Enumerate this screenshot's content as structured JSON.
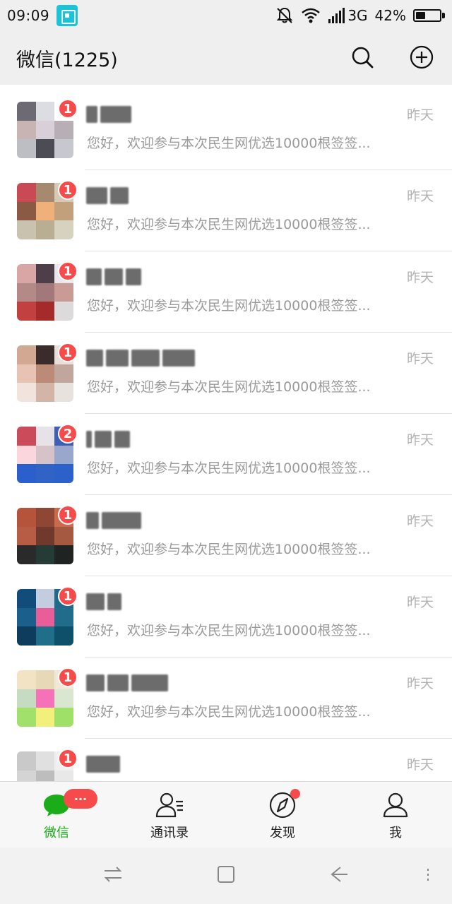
{
  "status_bar": {
    "time": "09:09",
    "network": "3G",
    "battery_percent": "42%",
    "battery_level": 0.42
  },
  "header": {
    "title": "微信(1225)",
    "icons": [
      "search-icon",
      "add-circle-icon"
    ]
  },
  "chats": [
    {
      "unread": "1",
      "time": "昨天",
      "preview": "您好，欢迎参与本次民生网优选10000根签签...",
      "avatar_colors": [
        "#6e6a73",
        "#dcdde2",
        "#ffffff",
        "#c9b4b4",
        "#d9cfd9",
        "#b8aeb5",
        "#bdbdc4",
        "#4c4c55",
        "#c7c7cf"
      ],
      "name_blocks": [
        16,
        44
      ]
    },
    {
      "unread": "1",
      "time": "昨天",
      "preview": "您好，欢迎参与本次民生网优选10000根签签...",
      "avatar_colors": [
        "#c94a55",
        "#a58a6f",
        "#d6c9b6",
        "#8a5a45",
        "#f0b07a",
        "#c2a07c",
        "#c9c2ae",
        "#b9ae92",
        "#d7d1c0"
      ],
      "name_blocks": [
        30,
        26
      ]
    },
    {
      "unread": "1",
      "time": "昨天",
      "preview": "您好，欢迎参与本次民生网优选10000根签签...",
      "avatar_colors": [
        "#d8a7a5",
        "#4e3e4a",
        "#e9e7ea",
        "#b48a86",
        "#a2787a",
        "#c89c94",
        "#c24040",
        "#a52a2a",
        "#dcdada"
      ],
      "name_blocks": [
        22,
        26,
        22
      ]
    },
    {
      "unread": "1",
      "time": "昨天",
      "preview": "您好，欢迎参与本次民生网优选10000根签签...",
      "avatar_colors": [
        "#d1a891",
        "#3a2c2a",
        "#e9dfd9",
        "#e7c3b3",
        "#bc8b77",
        "#c0a69c",
        "#f1e4dc",
        "#d2b5a7",
        "#e8e2de"
      ],
      "name_blocks": [
        24,
        32,
        40,
        46
      ]
    },
    {
      "unread": "2",
      "time": "昨天",
      "preview": "您好，欢迎参与本次民生网优选10000根签签...",
      "avatar_colors": [
        "#cc4b5a",
        "#e7e2e8",
        "#3d5fb4",
        "#fbd6dc",
        "#d6c3c7",
        "#9aa7cc",
        "#2a5fcc",
        "#3163c6",
        "#2b61c9"
      ],
      "name_blocks": [
        8,
        24,
        22
      ]
    },
    {
      "unread": "1",
      "time": "昨天",
      "preview": "您好，欢迎参与本次民生网优选10000根签签...",
      "avatar_colors": [
        "#b5533b",
        "#8d4733",
        "#c96a4e",
        "#b75c45",
        "#6f3a2b",
        "#a65941",
        "#2a2a2a",
        "#253b35",
        "#1f2422"
      ],
      "name_blocks": [
        18,
        56
      ]
    },
    {
      "unread": "1",
      "time": "昨天",
      "preview": "您好，欢迎参与本次民生网优选10000根签签...",
      "avatar_colors": [
        "#124c7a",
        "#c4cde0",
        "#1f6a8a",
        "#1b5f8c",
        "#e95e99",
        "#216c8a",
        "#0d3c5c",
        "#1f6e8a",
        "#0e4f6a"
      ],
      "name_blocks": [
        26,
        20
      ]
    },
    {
      "unread": "1",
      "time": "昨天",
      "preview": "您好，欢迎参与本次民生网优选10000根签签...",
      "avatar_colors": [
        "#f2e3c4",
        "#e7d8b8",
        "#efe8d6",
        "#c6dcc2",
        "#f572b9",
        "#d9e7d0",
        "#a1e06a",
        "#f2ef7a",
        "#9ee068"
      ],
      "name_blocks": [
        26,
        30,
        52
      ]
    },
    {
      "unread": "1",
      "time": "昨天",
      "preview": "",
      "avatar_colors": [
        "#c9c9c9",
        "#e0e0e0",
        "#efefef",
        "#d4d4d4",
        "#bdbdbd",
        "#e8e8e8",
        "#ccc",
        "#ddd",
        "#eee"
      ],
      "name_blocks": [
        48
      ]
    }
  ],
  "bottom_nav": {
    "items": [
      {
        "label": "微信",
        "icon": "chat-bubble-icon",
        "active": true
      },
      {
        "label": "通讯录",
        "icon": "contacts-icon",
        "active": false
      },
      {
        "label": "发现",
        "icon": "compass-icon",
        "active": false
      },
      {
        "label": "我",
        "icon": "person-icon",
        "active": false
      }
    ],
    "message_badge": "···"
  },
  "colors": {
    "accent_green": "#1aad19",
    "badge_red": "#f74b4b",
    "header_bg": "#efefef"
  }
}
